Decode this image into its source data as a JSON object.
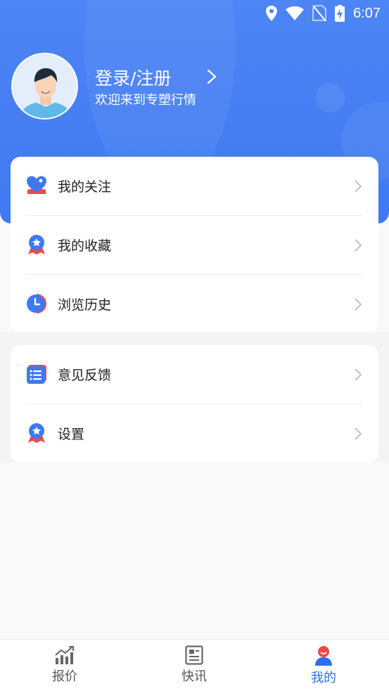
{
  "status_bar": {
    "time": "6:07",
    "icons": [
      "location-icon",
      "wifi-icon",
      "no-sim-icon",
      "battery-charging-icon"
    ]
  },
  "profile": {
    "login_label": "登录/注册",
    "welcome_text": "欢迎来到专塑行情",
    "avatar_icon": "user-avatar"
  },
  "menu_group_1": [
    {
      "label": "我的关注",
      "icon": "heart-follow-icon"
    },
    {
      "label": "我的收藏",
      "icon": "star-badge-icon"
    },
    {
      "label": "浏览历史",
      "icon": "clock-history-icon"
    }
  ],
  "menu_group_2": [
    {
      "label": "意见反馈",
      "icon": "feedback-list-icon"
    },
    {
      "label": "设置",
      "icon": "settings-badge-icon"
    }
  ],
  "bottom_nav": [
    {
      "label": "报价",
      "icon": "chart-trend-icon",
      "active": false
    },
    {
      "label": "快讯",
      "icon": "news-icon",
      "active": false
    },
    {
      "label": "我的",
      "icon": "user-icon",
      "active": true
    }
  ],
  "colors": {
    "primary": "#3f79f1",
    "accent_red": "#f0484a",
    "active_nav": "#2f6cf0"
  }
}
